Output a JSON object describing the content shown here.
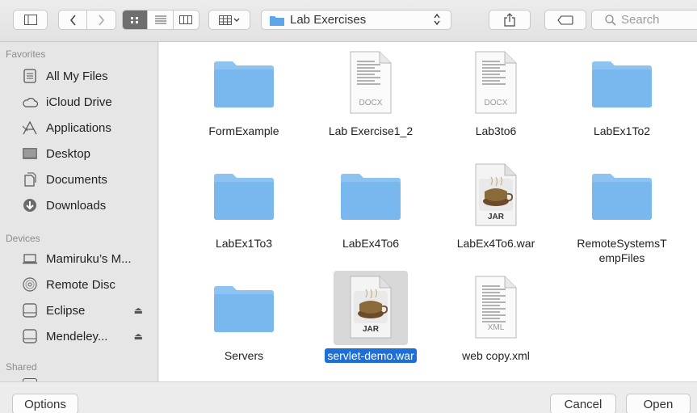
{
  "toolbar": {
    "path_name": "Lab Exercises",
    "search_placeholder": "Search",
    "icons": [
      "sidebar-toggle-icon",
      "back-icon",
      "forward-icon",
      "icon-view-icon",
      "list-view-icon",
      "column-view-icon",
      "arrange-icon",
      "folder-icon",
      "share-icon",
      "tag-icon",
      "search-icon"
    ]
  },
  "sidebar": {
    "favorites_heading": "Favorites",
    "favorites": [
      {
        "label": "All My Files",
        "icon": "all-files-icon"
      },
      {
        "label": "iCloud Drive",
        "icon": "cloud-icon"
      },
      {
        "label": "Applications",
        "icon": "applications-icon"
      },
      {
        "label": "Desktop",
        "icon": "desktop-icon"
      },
      {
        "label": "Documents",
        "icon": "documents-icon"
      },
      {
        "label": "Downloads",
        "icon": "downloads-icon"
      }
    ],
    "devices_heading": "Devices",
    "devices": [
      {
        "label": "Mamiruku’s M...",
        "icon": "laptop-icon"
      },
      {
        "label": "Remote Disc",
        "icon": "disc-icon"
      },
      {
        "label": "Eclipse",
        "icon": "drive-icon",
        "eject": "⏏"
      },
      {
        "label": "Mendeley...",
        "icon": "drive-icon",
        "eject": "⏏"
      }
    ],
    "shared_heading": "Shared"
  },
  "files": [
    {
      "name": "FormExample",
      "type": "folder"
    },
    {
      "name": "Lab Exercise1_2",
      "type": "docx",
      "badge": "DOCX"
    },
    {
      "name": "Lab3to6",
      "type": "docx",
      "badge": "DOCX"
    },
    {
      "name": "LabEx1To2",
      "type": "folder"
    },
    {
      "name": "LabEx1To3",
      "type": "folder"
    },
    {
      "name": "LabEx4To6",
      "type": "folder"
    },
    {
      "name": "LabEx4To6.war",
      "type": "jar",
      "badge": "JAR"
    },
    {
      "name": "RemoteSystemsTempFiles",
      "line1": "RemoteSystemsT",
      "line2": "empFiles",
      "type": "folder"
    },
    {
      "name": "Servers",
      "type": "folder"
    },
    {
      "name": "servlet-demo.war",
      "type": "jar",
      "badge": "JAR",
      "selected": true
    },
    {
      "name": "web copy.xml",
      "type": "xml",
      "badge": "XML"
    }
  ],
  "bottom": {
    "options_label": "Options",
    "cancel_label": "Cancel",
    "open_label": "Open"
  },
  "colors": {
    "selection": "#1d6fd6",
    "folder": "#79b8ee"
  }
}
